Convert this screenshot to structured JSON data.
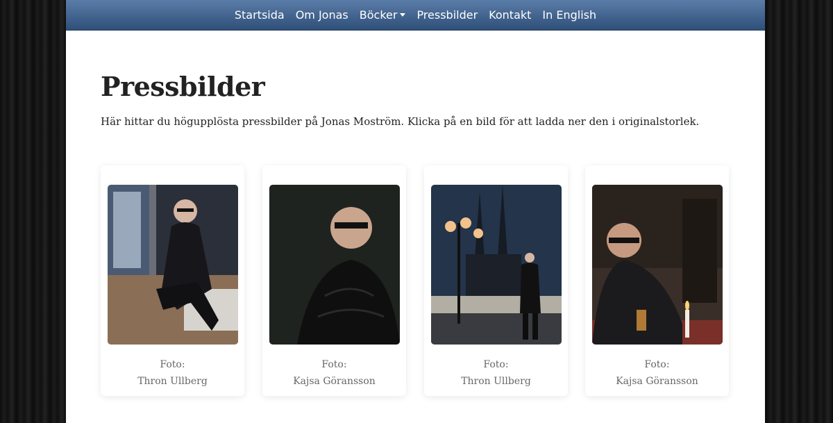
{
  "nav": {
    "items": [
      {
        "label": "Startsida"
      },
      {
        "label": "Om Jonas"
      },
      {
        "label": "Böcker"
      },
      {
        "label": "Pressbilder"
      },
      {
        "label": "Kontakt"
      },
      {
        "label": "In English"
      }
    ]
  },
  "main": {
    "title": "Pressbilder",
    "intro": "Här hittar du högupplösta pressbilder på Jonas Moström. Klicka på en bild för att ladda ner den i originalstorlek."
  },
  "photos": [
    {
      "caption_prefix": "Foto:",
      "photographer": "Thron Ullberg"
    },
    {
      "caption_prefix": "Foto:",
      "photographer": "Kajsa Göransson"
    },
    {
      "caption_prefix": "Foto:",
      "photographer": "Thron Ullberg"
    },
    {
      "caption_prefix": "Foto:",
      "photographer": "Kajsa Göransson"
    }
  ]
}
